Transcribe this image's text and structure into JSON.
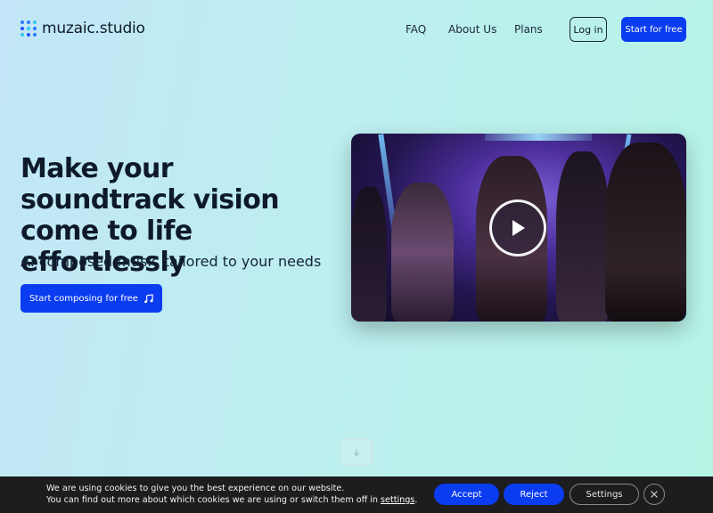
{
  "header": {
    "logo_text": "muzaic.studio",
    "nav": [
      {
        "label": "FAQ"
      },
      {
        "label": "About Us"
      },
      {
        "label": "Plans"
      }
    ],
    "login_label": "Log in",
    "start_label": "Start for free"
  },
  "hero": {
    "title": "Make your soundtrack vision come to life effortlessly",
    "subtitle": "AI composed music tailored to your needs",
    "cta_label": "Start composing for free"
  },
  "video": {
    "play_icon": "play-icon"
  },
  "cookie": {
    "line1": "We are using cookies to give you the best experience on our website.",
    "line2_prefix": "You can find out more about which cookies we are using or switch them off in ",
    "line2_link": "settings",
    "line2_suffix": ".",
    "accept_label": "Accept",
    "reject_label": "Reject",
    "settings_label": "Settings"
  },
  "colors": {
    "brand_blue": "#0a3cf0",
    "text_dark": "#0e1a2b",
    "cookie_bg": "#1d1d1f"
  }
}
